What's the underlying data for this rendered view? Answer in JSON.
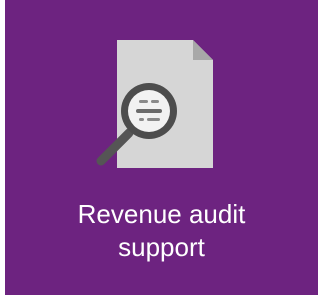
{
  "tile": {
    "label_line1": "Revenue audit",
    "label_line2": "support",
    "icon": "document-magnifier-icon",
    "colors": {
      "background": "#6d2380",
      "document": "#d6d6d6",
      "document_fold": "#a8a8a8",
      "lens_ring": "#4d4d4d",
      "lens_glass": "#f2f2f2",
      "handle": "#555555",
      "text": "#ffffff"
    }
  }
}
